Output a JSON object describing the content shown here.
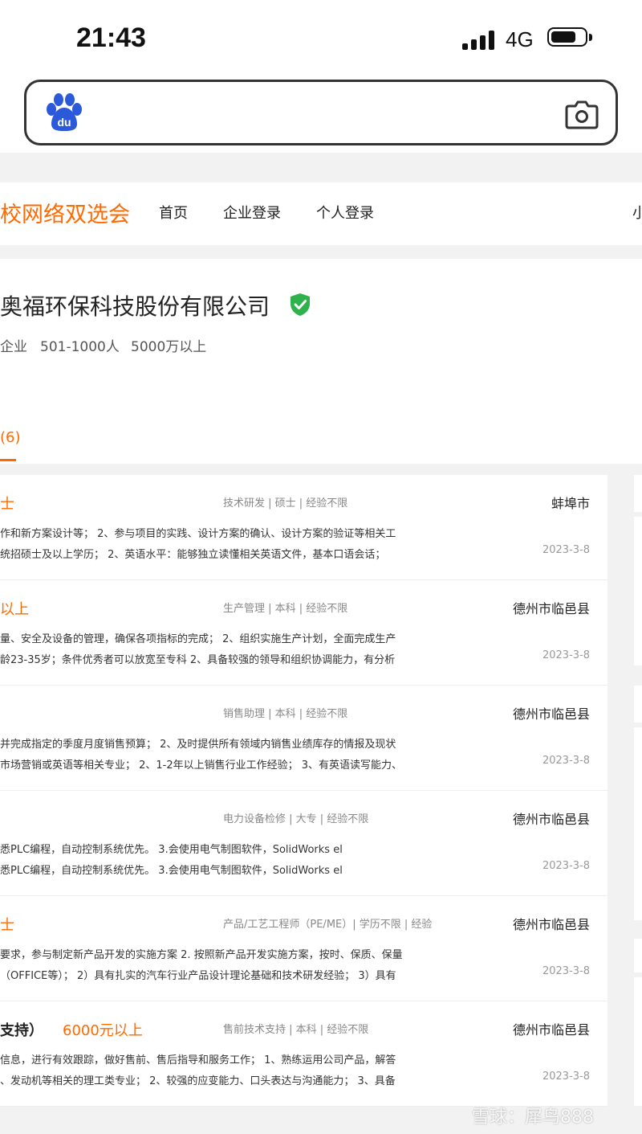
{
  "status_bar": {
    "time": "21:43",
    "network": "4G"
  },
  "nav": {
    "brand": "校网络双选会",
    "items": [
      "首页",
      "企业登录",
      "个人登录",
      "小"
    ]
  },
  "company": {
    "name": "奥福环保科技股份有限公司",
    "type": "企业",
    "size": "501-1000人",
    "capital": "5000万以上",
    "tab_label": "(6)"
  },
  "jobs": [
    {
      "title": "士",
      "salary": "",
      "tags": "技术研发 | 硕士 | 经验不限",
      "city": "蚌埠市",
      "desc1": "作和新方案设计等； 2、参与项目的实践、设计方案的确认、设计方案的验证等相关工",
      "desc2": "统招硕士及以上学历； 2、英语水平：能够独立读懂相关英语文件，基本口语会话；",
      "date": "2023-3-8"
    },
    {
      "title": "以上",
      "salary": "",
      "tags": "生产管理 | 本科 | 经验不限",
      "city": "德州市临邑县",
      "desc1": "量、安全及设备的管理，确保各项指标的完成； 2、组织实施生产计划，全面完成生产",
      "desc2": "龄23-35岁；条件优秀者可以放宽至专科 2、具备较强的领导和组织协调能力，有分析",
      "date": "2023-3-8"
    },
    {
      "title": "",
      "salary": "",
      "tags": "销售助理 | 本科 | 经验不限",
      "city": "德州市临邑县",
      "desc1": "并完成指定的季度月度销售预算； 2、及时提供所有领域内销售业绩库存的情报及现状",
      "desc2": "市场营销或英语等相关专业； 2、1-2年以上销售行业工作经验； 3、有英语读写能力、",
      "date": "2023-3-8"
    },
    {
      "title": "",
      "salary": "",
      "tags": "电力设备检修 | 大专 | 经验不限",
      "city": "德州市临邑县",
      "desc1": "悉PLC编程，自动控制系统优先。 3.会使用电气制图软件，SolidWorks el",
      "desc2": "悉PLC编程，自动控制系统优先。 3.会使用电气制图软件，SolidWorks el",
      "date": "2023-3-8"
    },
    {
      "title": "士",
      "salary": "",
      "tags": "产品/工艺工程师（PE/ME）| 学历不限 | 经验",
      "city": "德州市临邑县",
      "desc1": "要求，参与制定新产品开发的实施方案 2. 按照新产品开发实施方案，按时、保质、保量",
      "desc2": "（OFFICE等）； 2）具有扎实的汽车行业产品设计理论基础和技术研发经验； 3）具有",
      "date": "2023-3-8"
    },
    {
      "title": "支持）",
      "salary": "6000元以上",
      "tags": "售前技术支持 | 本科 | 经验不限",
      "city": "德州市临邑县",
      "desc1": "信息，进行有效跟踪，做好售前、售后指导和服务工作； 1、熟练运用公司产品，解答",
      "desc2": "、发动机等相关的理工类专业； 2、较强的应变能力、口头表达与沟通能力； 3、具备",
      "date": "2023-3-8"
    }
  ],
  "watermark": "雪球：犀鸟888",
  "colors": {
    "accent": "#ff6a00",
    "verified": "#2fb24c",
    "baidu_blue": "#2b59d9"
  },
  "icons": [
    "baidu-logo-icon",
    "camera-icon",
    "verified-shield-icon",
    "signal-icon",
    "battery-icon"
  ]
}
